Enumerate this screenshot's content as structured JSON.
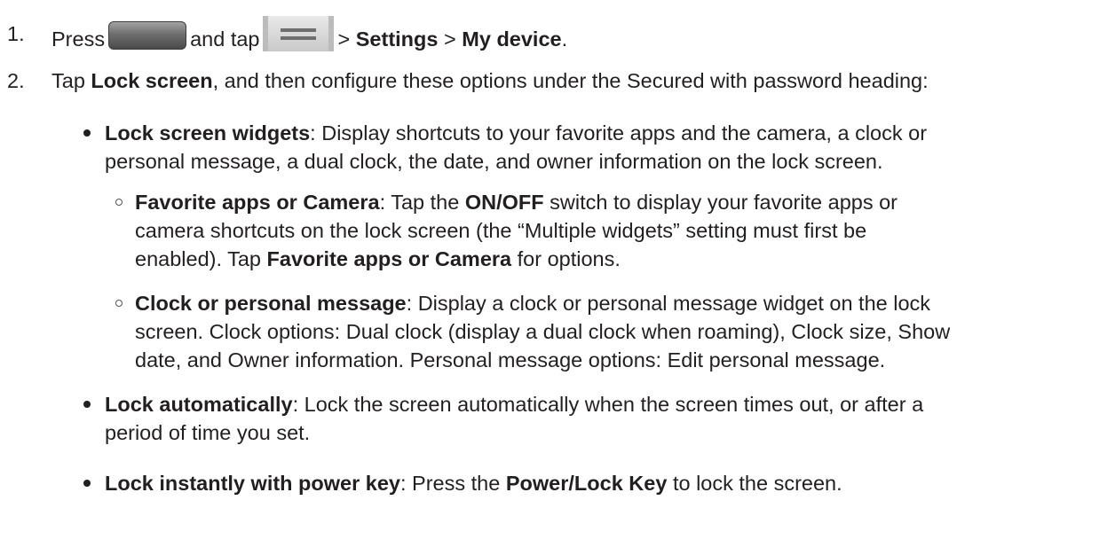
{
  "step1": {
    "number": "1.",
    "press": "Press",
    "and_tap": "and tap",
    "sep1": ">",
    "settings": "Settings",
    "sep2": ">",
    "my_device": "My device",
    "end": ".",
    "home_key_icon": "home-key-icon",
    "menu_key_icon": "menu-key-icon"
  },
  "step2": {
    "number": "2.",
    "tap": "Tap",
    "lock_screen": "Lock screen",
    "rest": ", and then configure these options under the Secured with password heading:"
  },
  "bullets": {
    "widgets": {
      "term": "Lock screen widgets",
      "text_line1": ": Display shortcuts to your favorite apps and the camera, a clock or",
      "text_line2": "personal message, a dual clock, the date, and owner information on the lock screen."
    },
    "fav": {
      "term": "Favorite apps or Camera",
      "pre": ": Tap the",
      "switch": "ON/OFF",
      "post": "switch to display your favorite apps or",
      "line2": "camera shortcuts on the lock screen (the “Multiple widgets” setting must first be",
      "line3_pre": "enabled). Tap",
      "line3_term": "Favorite apps or Camera",
      "line3_post": "for options."
    },
    "clock": {
      "term": "Clock or personal message",
      "line1": ": Display a clock or personal message widget on the lock",
      "line2": "screen. Clock options: Dual clock (display a dual clock when roaming), Clock size, Show",
      "line3": "date, and Owner information. Personal message options: Edit personal message."
    },
    "auto": {
      "term": "Lock automatically",
      "line1": ": Lock the screen automatically when the screen times out, or after a",
      "line2": "period of time you set."
    },
    "power": {
      "term": "Lock instantly with power key",
      "pre": ": Press the",
      "key": "Power/Lock Key",
      "post": "to lock the screen."
    }
  }
}
